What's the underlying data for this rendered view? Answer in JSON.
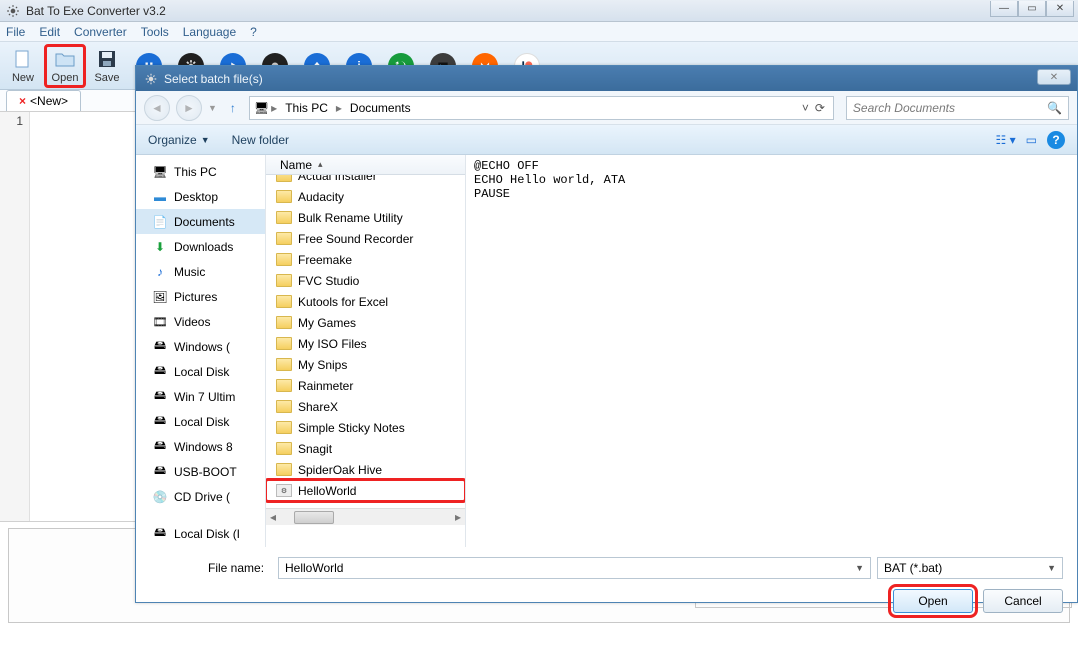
{
  "window": {
    "title": "Bat To Exe Converter v3.2"
  },
  "menu": {
    "file": "File",
    "edit": "Edit",
    "converter": "Converter",
    "tools": "Tools",
    "language": "Language",
    "help": "?"
  },
  "toolbar": {
    "new": "New",
    "open": "Open",
    "save": "Save"
  },
  "tab": {
    "name": "<New>"
  },
  "gutter": {
    "line1": "1"
  },
  "dialog": {
    "title": "Select batch file(s)",
    "breadcrumb": {
      "root": "This PC",
      "folder": "Documents"
    },
    "search_placeholder": "Search Documents",
    "organize": "Organize",
    "newfolder": "New folder",
    "header": {
      "name": "Name"
    },
    "nav": {
      "thispc": "This PC",
      "desktop": "Desktop",
      "documents": "Documents",
      "downloads": "Downloads",
      "music": "Music",
      "pictures": "Pictures",
      "videos": "Videos",
      "windows1": "Windows (",
      "localdisk1": "Local Disk",
      "win7": "Win 7 Ultim",
      "localdisk2": "Local Disk",
      "windows8": "Windows 8",
      "usbboot": "USB-BOOT",
      "cddrive": "CD Drive (",
      "localdisk3": "Local Disk (I"
    },
    "files": {
      "f0": "Actual Installer",
      "f1": "Audacity",
      "f2": "Bulk Rename Utility",
      "f3": "Free Sound Recorder",
      "f4": "Freemake",
      "f5": "FVC Studio",
      "f6": "Kutools for Excel",
      "f7": "My Games",
      "f8": "My ISO Files",
      "f9": "My Snips",
      "f10": "Rainmeter",
      "f11": "ShareX",
      "f12": "Simple Sticky Notes",
      "f13": "Snagit",
      "f14": "SpiderOak Hive",
      "f15": "HelloWorld"
    },
    "preview": "@ECHO OFF\nECHO Hello world, ATA\nPAUSE",
    "filename_label": "File name:",
    "filename_value": "HelloWorld",
    "filter": "BAT (*.bat)",
    "open_btn": "Open",
    "cancel_btn": "Cancel"
  }
}
